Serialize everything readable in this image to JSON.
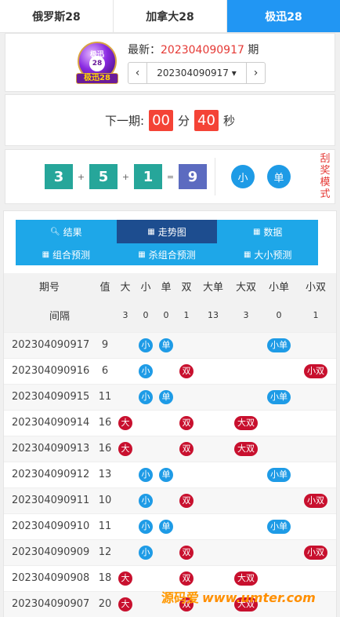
{
  "tabs": [
    {
      "label": "俄罗斯28",
      "active": false
    },
    {
      "label": "加拿大28",
      "active": false
    },
    {
      "label": "极迅28",
      "active": true
    }
  ],
  "logo": {
    "ball_text": "极迅",
    "ball_num": "28",
    "band": "极迅28"
  },
  "latest": {
    "prefix": "最新：",
    "issue": "202304090917",
    "suffix": " 期",
    "selected_issue": "202304090917 ▾"
  },
  "countdown": {
    "label": "下一期:",
    "minutes": "00",
    "min_unit": "分",
    "seconds": "40",
    "sec_unit": "秒"
  },
  "result": {
    "n1": "3",
    "n2": "5",
    "n3": "1",
    "sum": "9",
    "plus": "+",
    "equals": "=",
    "size": "小",
    "parity": "单",
    "scratch": "刮奖模式"
  },
  "menu": {
    "row1": [
      "结果",
      "走势图",
      "数据"
    ],
    "row2": [
      "组合预测",
      "杀组合预测",
      "大小预测"
    ]
  },
  "table": {
    "headers": [
      "期号",
      "值",
      "大",
      "小",
      "单",
      "双",
      "大单",
      "大双",
      "小单",
      "小双"
    ],
    "gap_label": "间隔",
    "gaps": [
      "3",
      "0",
      "0",
      "1",
      "13",
      "3",
      "0",
      "1"
    ],
    "rows": [
      {
        "issue": "202304090917",
        "value": "9",
        "da": "",
        "xiao": "小",
        "dan": "单",
        "shuang": "",
        "dadan": "",
        "dashuang": "",
        "xiaodan": "小单",
        "xiaoshuang": ""
      },
      {
        "issue": "202304090916",
        "value": "6",
        "da": "",
        "xiao": "小",
        "dan": "",
        "shuang": "双",
        "dadan": "",
        "dashuang": "",
        "xiaodan": "",
        "xiaoshuang": "小双"
      },
      {
        "issue": "202304090915",
        "value": "11",
        "da": "",
        "xiao": "小",
        "dan": "单",
        "shuang": "",
        "dadan": "",
        "dashuang": "",
        "xiaodan": "小单",
        "xiaoshuang": ""
      },
      {
        "issue": "202304090914",
        "value": "16",
        "da": "大",
        "xiao": "",
        "dan": "",
        "shuang": "双",
        "dadan": "",
        "dashuang": "大双",
        "xiaodan": "",
        "xiaoshuang": ""
      },
      {
        "issue": "202304090913",
        "value": "16",
        "da": "大",
        "xiao": "",
        "dan": "",
        "shuang": "双",
        "dadan": "",
        "dashuang": "大双",
        "xiaodan": "",
        "xiaoshuang": ""
      },
      {
        "issue": "202304090912",
        "value": "13",
        "da": "",
        "xiao": "小",
        "dan": "单",
        "shuang": "",
        "dadan": "",
        "dashuang": "",
        "xiaodan": "小单",
        "xiaoshuang": ""
      },
      {
        "issue": "202304090911",
        "value": "10",
        "da": "",
        "xiao": "小",
        "dan": "",
        "shuang": "双",
        "dadan": "",
        "dashuang": "",
        "xiaodan": "",
        "xiaoshuang": "小双"
      },
      {
        "issue": "202304090910",
        "value": "11",
        "da": "",
        "xiao": "小",
        "dan": "单",
        "shuang": "",
        "dadan": "",
        "dashuang": "",
        "xiaodan": "小单",
        "xiaoshuang": ""
      },
      {
        "issue": "202304090909",
        "value": "12",
        "da": "",
        "xiao": "小",
        "dan": "",
        "shuang": "双",
        "dadan": "",
        "dashuang": "",
        "xiaodan": "",
        "xiaoshuang": "小双"
      },
      {
        "issue": "202304090908",
        "value": "18",
        "da": "大",
        "xiao": "",
        "dan": "",
        "shuang": "双",
        "dadan": "",
        "dashuang": "大双",
        "xiaodan": "",
        "xiaoshuang": ""
      },
      {
        "issue": "202304090907",
        "value": "20",
        "da": "大",
        "xiao": "",
        "dan": "",
        "shuang": "双",
        "dadan": "",
        "dashuang": "大双",
        "xiaodan": "",
        "xiaoshuang": ""
      }
    ]
  },
  "watermark": {
    "cn": "源码爱",
    "url": "www.umter.com"
  },
  "colors": {
    "accent": "#2196f3",
    "num_green": "#26a69a",
    "sum_purple": "#5c6bc0",
    "red": "#f44336",
    "badge_blue": "#1e9be6",
    "badge_red": "#c8102e",
    "menu_active": "#1d4d8f",
    "menu_bg": "#1ea7e8"
  }
}
